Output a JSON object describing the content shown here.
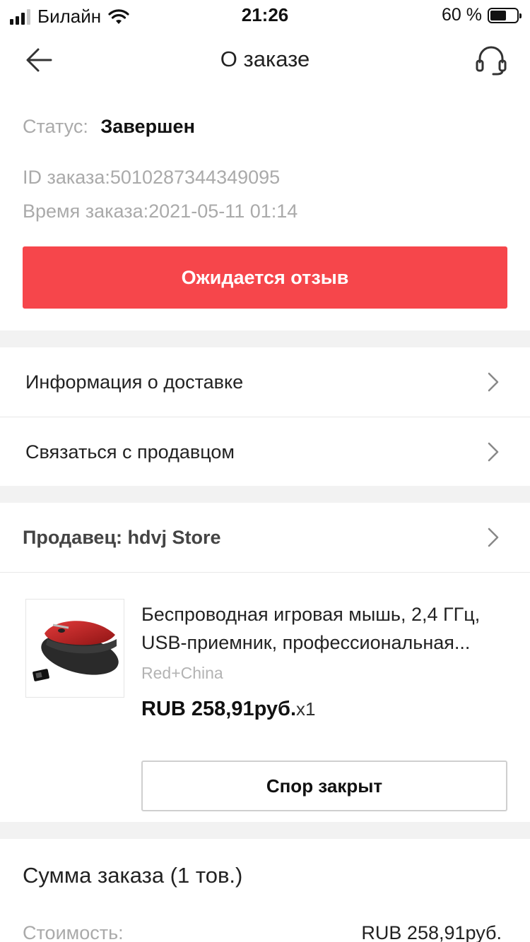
{
  "status_bar": {
    "carrier": "Билайн",
    "time": "21:26",
    "battery_percent": "60 %",
    "battery_level": 0.6
  },
  "header": {
    "title": "О заказе",
    "back_icon": "arrow-left-icon",
    "support_icon": "headset-icon"
  },
  "order": {
    "status_label": "Статус:",
    "status_value": "Завершен",
    "id_text": "ID заказа:5010287344349095",
    "time_text": "Время заказа:2021-05-11 01:14",
    "review_button": "Ожидается отзыв"
  },
  "links": {
    "delivery_info": "Информация о доставке",
    "contact_seller": "Связаться с продавцом"
  },
  "seller": {
    "label": "Продавец: hdvj Store"
  },
  "product": {
    "title_line1": "Беспроводная игровая мышь, 2,4 ГГц,",
    "title_line2": "USB-приемник, профессиональная...",
    "variant": "Red+China",
    "price": "RUB 258,91руб.",
    "quantity": "x1",
    "dispute_button": "Спор закрыт"
  },
  "summary": {
    "title": "Сумма заказа (1 тов.)",
    "cost_label": "Стоимость:",
    "cost_value": "RUB 258,91руб."
  },
  "colors": {
    "accent": "#f6464b",
    "muted_text": "#aaaaaa",
    "section_gap": "#f2f2f2"
  }
}
